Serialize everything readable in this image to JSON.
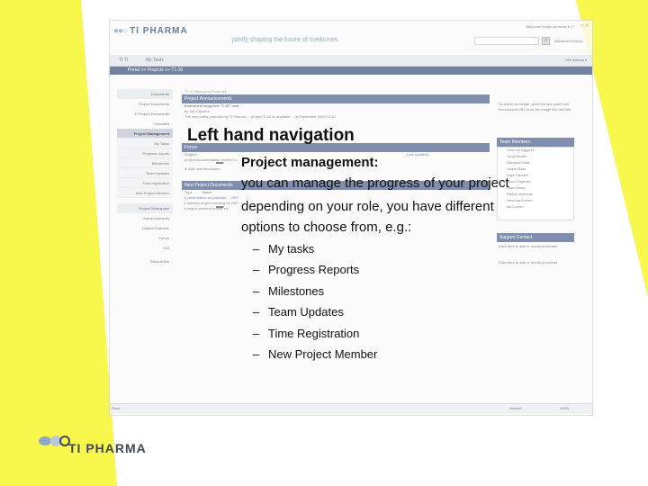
{
  "colors": {
    "slide_yellow": "#f7f74c",
    "navy": "#3e5a8a",
    "panel_blue": "#5b6f96"
  },
  "app": {
    "logo_text": "TI PHARMA",
    "tagline": "jointly shaping the future of medicines",
    "user_link": "Welcome Margo Armonie ▾ |  ?",
    "close": "□ ✕",
    "search_icon": "magnifier-icon",
    "search_button": "⌕",
    "advanced_search": "Advanced Search"
  },
  "tabs": [
    {
      "label": "TI TI"
    },
    {
      "label": "My Tools"
    }
  ],
  "tab_tools": "Site Actions ▾",
  "breadcrumb": "Portal  >>  Projects  >>  T1-10",
  "sidebar": {
    "items": [
      {
        "label": "Documents",
        "kind": "head"
      },
      {
        "label": "Project Documents",
        "kind": "plain"
      },
      {
        "label": "TI Project Documents",
        "kind": "plain"
      },
      {
        "label": "Favorites",
        "kind": "plain"
      },
      {
        "label": "Project Management",
        "kind": "active"
      },
      {
        "label": "My Tasks",
        "kind": "sub"
      },
      {
        "label": "Progress reports",
        "kind": "sub"
      },
      {
        "label": "Milestones",
        "kind": "sub"
      },
      {
        "label": "Team Updates",
        "kind": "sub"
      },
      {
        "label": "Time registration",
        "kind": "sub"
      },
      {
        "label": "New Project Member",
        "kind": "sub"
      },
      {
        "label": "Project Workspace",
        "kind": "head"
      },
      {
        "label": "Announcements",
        "kind": "plain"
      },
      {
        "label": "Project Calendar",
        "kind": "plain"
      },
      {
        "label": "Forum",
        "kind": "plain"
      },
      {
        "label": "Poll",
        "kind": "plain"
      },
      {
        "label": "Recycle Bin",
        "kind": "plain"
      }
    ]
  },
  "main": {
    "path": "T1-10 Biological Pharma ▸",
    "announcements_title": "Project Announcements",
    "announcement_line1": "Instrument inquiries \"T-10\" new",
    "announcement_line2": "by Jan Claudes",
    "announcement_line3": "The new notes prepared by TI Pharma ... project TI-10 is available ... in September 2009 10:32",
    "forum_title": "Forum",
    "forum_col1": "Subject",
    "forum_col2": "Last Updated",
    "forum_row": "project documentation review T-1",
    "add_forum": "⊕ Add new discussion",
    "newdocs_title": "New Project Documents",
    "newdocs_col1": "Type",
    "newdocs_col2": "Name",
    "newdocs_col3": "Modified By",
    "newdocs_rows": [
      "presentation on pathway ... 2007",
      "minutes project meeting 06 2007",
      "project protocol review xls"
    ]
  },
  "right": {
    "intro": "To add to an image, open the tool panel and then submit URL to be the image link and title.",
    "team_title": "Team Members",
    "members": [
      "Jean-Luc Tyggeren",
      "Jacob Meulen",
      "Katharina Hollis",
      "Jansen-Baas",
      "Ralph Pijlmann",
      "Rocco Gilgamss",
      "Haas Jansen",
      "Rachel Leiderman",
      "Hans van Bruhlen",
      "Ian Crusten"
    ],
    "support_title": "Support Contact",
    "support_text1": "Click here to add or modify a contact",
    "support_text2": "Click here to add or modify a contact"
  },
  "status": {
    "done": "Done",
    "network": "Internet",
    "zoom": "100%"
  },
  "slide": {
    "title": "Left hand navigation",
    "bullets": [
      {
        "dash": "–",
        "line1": "Project management:",
        "line2": "you can manage the progress of your project"
      },
      {
        "dash": "–",
        "line1": "depending on your role, you have different",
        "line2": "options to choose from, e.g.:"
      }
    ],
    "subitems": [
      "My tasks",
      "Progress Reports",
      "Milestones",
      "Team Updates",
      "Time Registration",
      "New Project Member"
    ],
    "subdash": "–"
  },
  "footer_logo": {
    "text": "TI PHARMA"
  }
}
